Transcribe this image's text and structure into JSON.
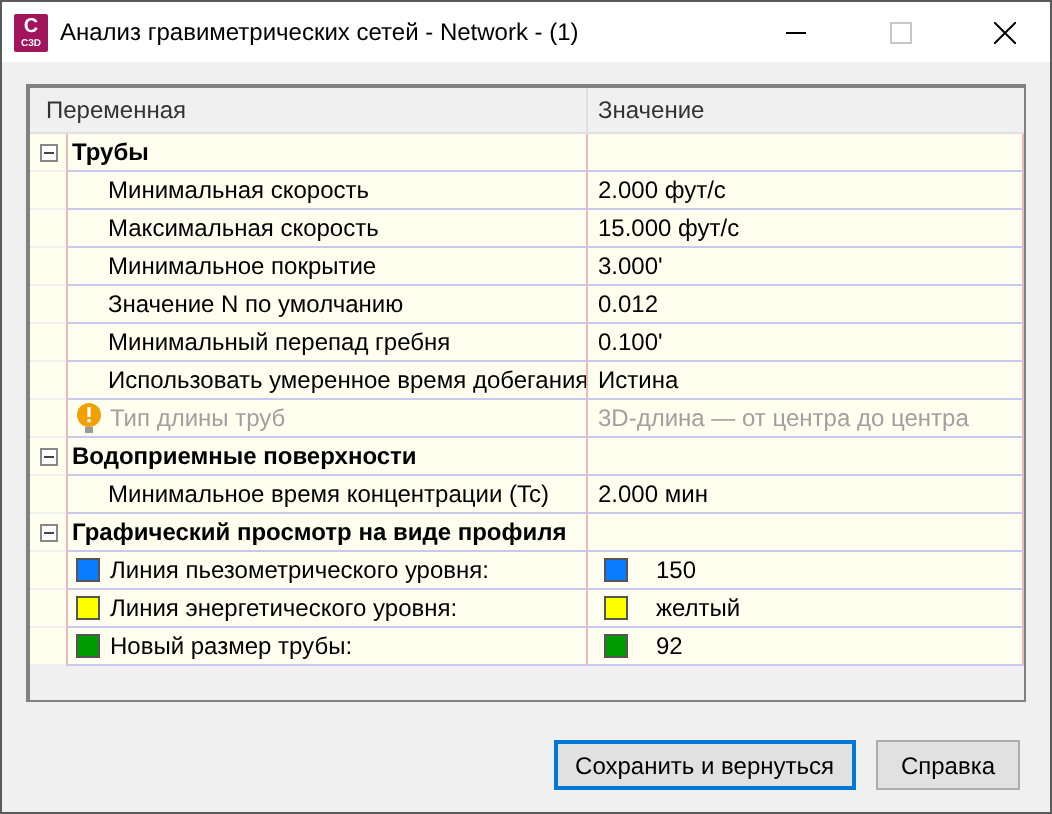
{
  "window": {
    "title": "Анализ гравиметрических сетей - Network - (1)",
    "app_icon_text": "C",
    "app_icon_subtext": "C3D"
  },
  "grid": {
    "columns": [
      "Переменная",
      "Значение"
    ],
    "groups": [
      {
        "name": "Трубы",
        "expanded": true,
        "items": [
          {
            "kind": "text",
            "name": "Минимальная скорость",
            "value": "2.000 фут/с",
            "disabled": false
          },
          {
            "kind": "text",
            "name": "Максимальная скорость",
            "value": "15.000 фут/с",
            "disabled": false
          },
          {
            "kind": "text",
            "name": "Минимальное покрытие",
            "value": "3.000'",
            "disabled": false
          },
          {
            "kind": "text",
            "name": "Значение N по умолчанию",
            "value": "0.012",
            "disabled": false
          },
          {
            "kind": "text",
            "name": "Минимальный перепад гребня",
            "value": "0.100'",
            "disabled": false
          },
          {
            "kind": "text",
            "name": "Использовать умеренное время добегания",
            "value": "Истина",
            "disabled": false
          },
          {
            "kind": "warning",
            "name": "Тип длины труб",
            "value": "3D-длина — от центра до центра",
            "disabled": true
          }
        ]
      },
      {
        "name": "Водоприемные поверхности",
        "expanded": true,
        "items": [
          {
            "kind": "text",
            "name": "Минимальное время концентрации (Tc)",
            "value": "2.000 мин",
            "disabled": false
          }
        ]
      },
      {
        "name": "Графический просмотр на виде профиля",
        "expanded": true,
        "items": [
          {
            "kind": "color",
            "name": "Линия пьезометрического уровня:",
            "value": "150",
            "color": "#0a7cff",
            "disabled": false
          },
          {
            "kind": "color",
            "name": "Линия энергетического уровня:",
            "value": "желтый",
            "color": "#ffff00",
            "disabled": false
          },
          {
            "kind": "color",
            "name": "Новый размер трубы:",
            "value": "92",
            "color": "#009b00",
            "disabled": false
          }
        ]
      }
    ]
  },
  "buttons": [
    {
      "label": "Сохранить и вернуться",
      "default": true
    },
    {
      "label": "Справка",
      "default": false
    }
  ]
}
